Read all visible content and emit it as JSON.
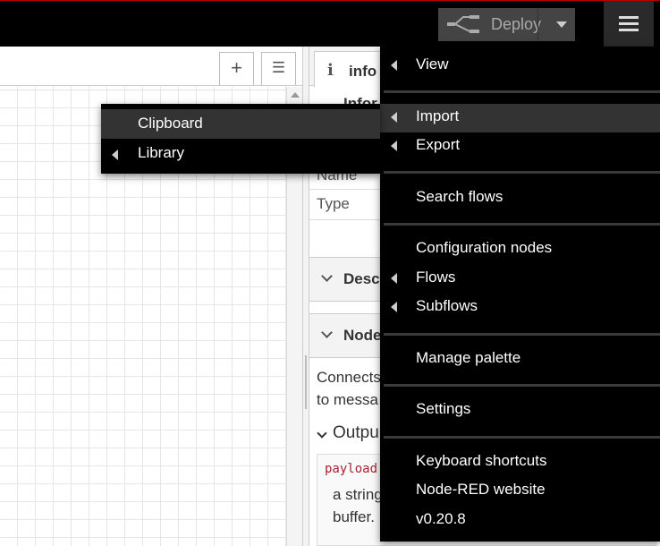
{
  "header": {
    "deploy_label": "Deploy"
  },
  "workspace": {
    "add_flow_symbol": "+",
    "list_flows_symbol": "☰"
  },
  "sidebar": {
    "tab_icon": "i",
    "tab_label": "info",
    "info_heading": "Infor",
    "rows": {
      "name_label": "Name",
      "type_label": "Type"
    },
    "sections": {
      "description_title": "Desc",
      "node_help_title": "Node"
    },
    "help_text": {
      "line1": "Connects",
      "line2": "to messa"
    },
    "outputs_label": "Outpu",
    "code_label": "payload",
    "output_desc_line1": "a string",
    "output_desc_line2": "buffer."
  },
  "main_menu": {
    "items": {
      "view": "View",
      "import": "Import",
      "export": "Export",
      "search_flows": "Search flows",
      "configuration_nodes": "Configuration nodes",
      "flows": "Flows",
      "subflows": "Subflows",
      "manage_palette": "Manage palette",
      "settings": "Settings",
      "keyboard_shortcuts": "Keyboard shortcuts",
      "node_red_website": "Node-RED website",
      "version": "v0.20.8"
    }
  },
  "import_submenu": {
    "clipboard": "Clipboard",
    "library": "Library"
  },
  "colors": {
    "header_bg": "#000000",
    "menu_bg": "#000000",
    "menu_active": "#333333",
    "deploy_bg": "#444444",
    "accent_red": "#b30000"
  }
}
